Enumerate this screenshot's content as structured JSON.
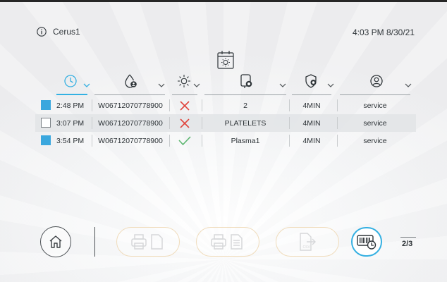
{
  "header": {
    "device_name": "Cerus1",
    "clock": "4:03 PM 8/30/21"
  },
  "table": {
    "columns": [
      {
        "id": "time",
        "icon": "clock-icon",
        "sorted": true
      },
      {
        "id": "id",
        "icon": "donor-drop-icon",
        "sorted": false
      },
      {
        "id": "illumination",
        "icon": "illumination-icon",
        "sorted": false
      },
      {
        "id": "product",
        "icon": "product-bag-icon",
        "sorted": false
      },
      {
        "id": "treatment",
        "icon": "treatment-shield-icon",
        "sorted": false
      },
      {
        "id": "operator",
        "icon": "user-icon",
        "sorted": false
      }
    ],
    "rows": [
      {
        "selected": true,
        "time": "2:48 PM",
        "id": "W06712070778900",
        "status": "fail",
        "product": "2",
        "duration": "4MIN",
        "user": "service"
      },
      {
        "selected": false,
        "time": "3:07 PM",
        "id": "W06712070778900",
        "status": "fail",
        "product": "PLATELETS",
        "duration": "4MIN",
        "user": "service"
      },
      {
        "selected": true,
        "time": "3:54 PM",
        "id": "W06712070778900",
        "status": "pass",
        "product": "Plasma1",
        "duration": "4MIN",
        "user": "service"
      }
    ]
  },
  "footer": {
    "page_indicator": "2/3",
    "buttons": [
      {
        "name": "home-button",
        "icon": "home-icon",
        "enabled": true
      },
      {
        "name": "print-summary-button",
        "icon": "print-page-icon",
        "enabled": false
      },
      {
        "name": "print-detail-button",
        "icon": "print-document-icon",
        "enabled": false
      },
      {
        "name": "export-csv-button",
        "icon": "csv-export-icon",
        "enabled": false
      },
      {
        "name": "barcode-scan-button",
        "icon": "barcode-scan-icon",
        "enabled": true
      }
    ]
  },
  "colors": {
    "accent": "#35b0e2",
    "checkbox_selected": "#3aa7de",
    "fail": "#e0443c",
    "pass": "#5ab56e",
    "disabled_outline": "#f0dcbc"
  }
}
